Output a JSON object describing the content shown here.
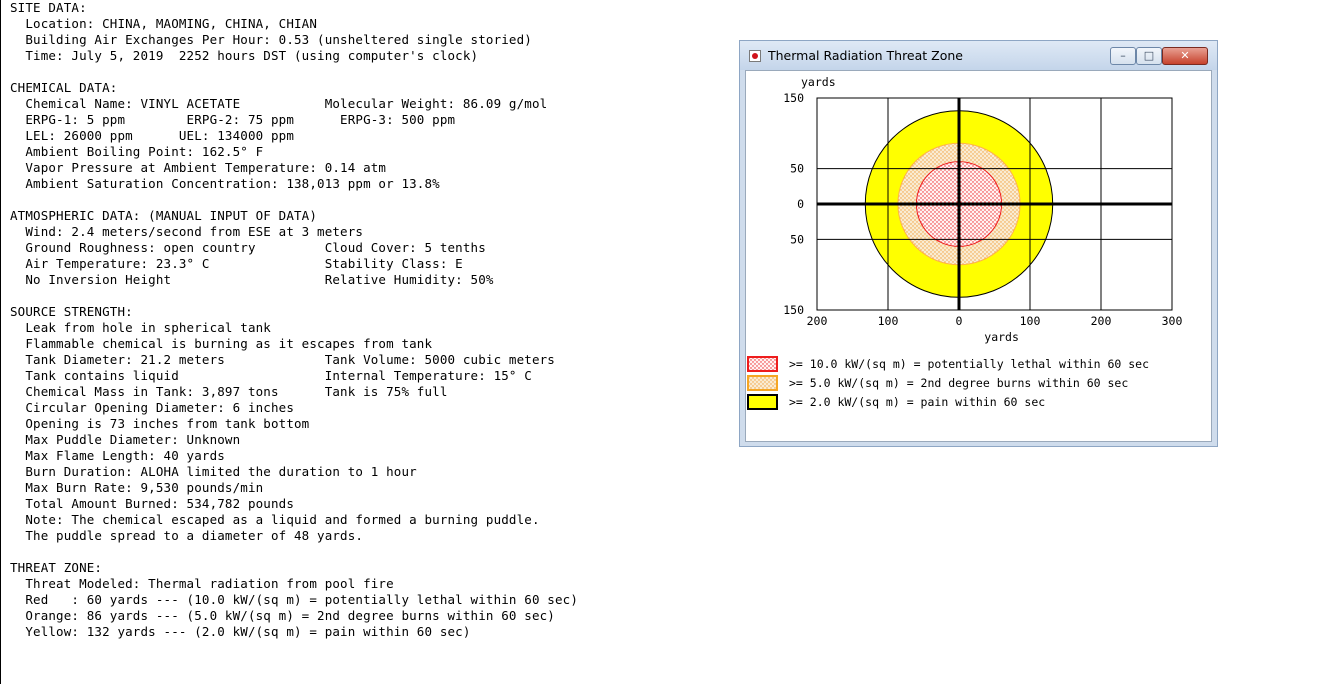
{
  "report": {
    "lines": [
      "SITE DATA:",
      "  Location: CHINA, MAOMING, CHINA, CHIAN",
      "  Building Air Exchanges Per Hour: 0.53 (unsheltered single storied)",
      "  Time: July 5, 2019  2252 hours DST (using computer's clock)",
      "",
      "CHEMICAL DATA:",
      "  Chemical Name: VINYL ACETATE           Molecular Weight: 86.09 g/mol",
      "  ERPG-1: 5 ppm        ERPG-2: 75 ppm      ERPG-3: 500 ppm",
      "  LEL: 26000 ppm      UEL: 134000 ppm",
      "  Ambient Boiling Point: 162.5° F",
      "  Vapor Pressure at Ambient Temperature: 0.14 atm",
      "  Ambient Saturation Concentration: 138,013 ppm or 13.8%",
      "",
      "ATMOSPHERIC DATA: (MANUAL INPUT OF DATA)",
      "  Wind: 2.4 meters/second from ESE at 3 meters",
      "  Ground Roughness: open country         Cloud Cover: 5 tenths",
      "  Air Temperature: 23.3° C               Stability Class: E",
      "  No Inversion Height                    Relative Humidity: 50%",
      "",
      "SOURCE STRENGTH:",
      "  Leak from hole in spherical tank",
      "  Flammable chemical is burning as it escapes from tank",
      "  Tank Diameter: 21.2 meters             Tank Volume: 5000 cubic meters",
      "  Tank contains liquid                   Internal Temperature: 15° C",
      "  Chemical Mass in Tank: 3,897 tons      Tank is 75% full",
      "  Circular Opening Diameter: 6 inches",
      "  Opening is 73 inches from tank bottom",
      "  Max Puddle Diameter: Unknown",
      "  Max Flame Length: 40 yards",
      "  Burn Duration: ALOHA limited the duration to 1 hour",
      "  Max Burn Rate: 9,530 pounds/min",
      "  Total Amount Burned: 534,782 pounds",
      "  Note: The chemical escaped as a liquid and formed a burning puddle.",
      "  The puddle spread to a diameter of 48 yards.",
      "",
      "THREAT ZONE:",
      "  Threat Modeled: Thermal radiation from pool fire",
      "  Red   : 60 yards --- (10.0 kW/(sq m) = potentially lethal within 60 sec)",
      "  Orange: 86 yards --- (5.0 kW/(sq m) = 2nd degree burns within 60 sec)",
      "  Yellow: 132 yards --- (2.0 kW/(sq m) = pain within 60 sec)"
    ]
  },
  "window": {
    "title": "Thermal Radiation Threat Zone",
    "minimize_glyph": "–",
    "maximize_glyph": "□",
    "close_glyph": "✕"
  },
  "chart_data": {
    "type": "threat_zone_plot",
    "ylabel": "yards",
    "xlabel": "yards",
    "xlim": [
      -200,
      300
    ],
    "ylim": [
      -150,
      150
    ],
    "x_ticks": [
      -200,
      -100,
      0,
      100,
      200,
      300
    ],
    "x_tick_labels": [
      "200",
      "100",
      "0",
      "100",
      "200",
      "300"
    ],
    "y_ticks": [
      150,
      50,
      0,
      -50,
      -150
    ],
    "y_tick_labels": [
      "150",
      "50",
      "0",
      "50",
      "150"
    ],
    "grid": true,
    "zones": [
      {
        "name": "yellow",
        "radius": 132,
        "fill": "#ffff00",
        "pattern": "solid",
        "legend": ">= 2.0 kW/(sq m) = pain within 60 sec"
      },
      {
        "name": "orange",
        "radius": 86,
        "fill": "#f5deb3",
        "stroke": "#ffb24a",
        "pattern": "dots-orange",
        "legend": ">= 5.0 kW/(sq m) = 2nd degree burns within 60 sec"
      },
      {
        "name": "red",
        "radius": 60,
        "fill": "#fff0f0",
        "stroke": "#ee1c1c",
        "pattern": "dots-red",
        "legend": ">= 10.0 kW/(sq m) = potentially lethal within 60 sec"
      }
    ],
    "legend_order": [
      "red",
      "orange",
      "yellow"
    ],
    "colors": {
      "red": "#ee1c1c",
      "orange": "#f5a623",
      "yellow": "#ffff00"
    }
  }
}
